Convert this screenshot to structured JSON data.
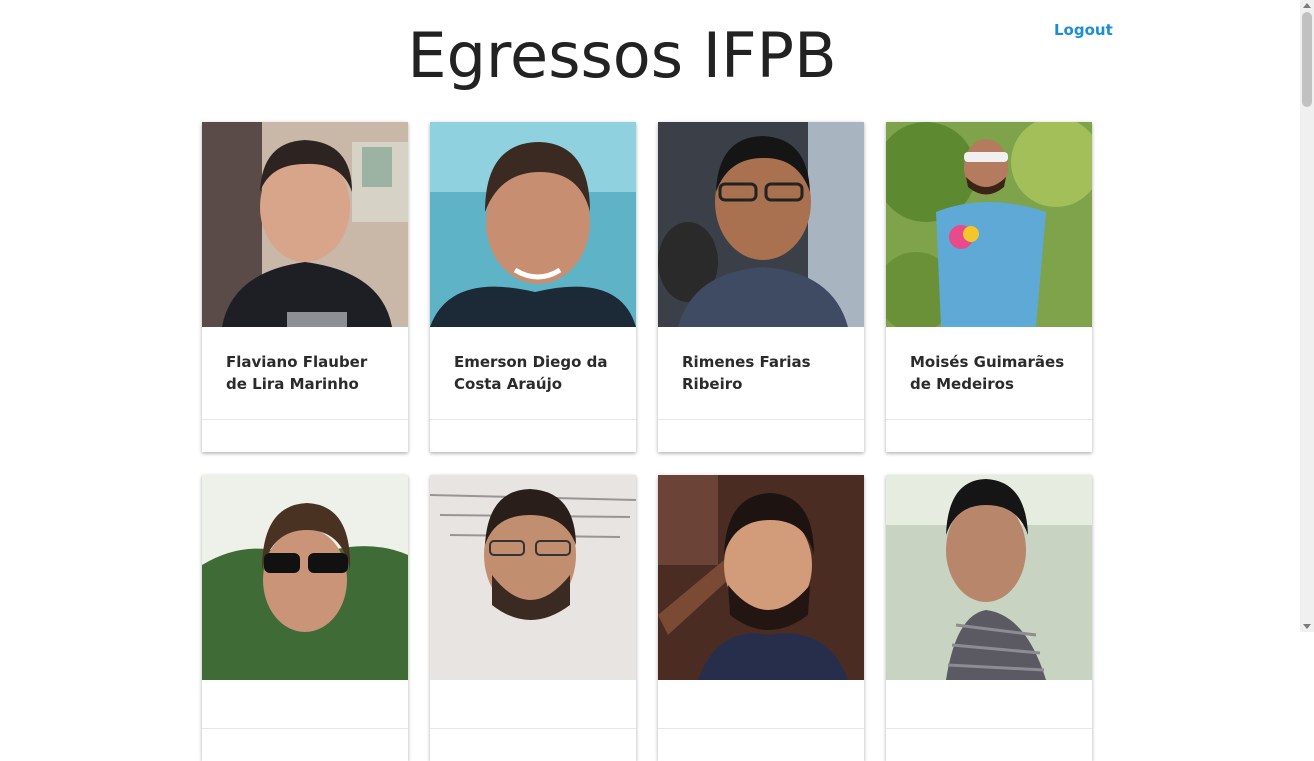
{
  "header": {
    "title": "Egressos IFPB",
    "logout_label": "Logout"
  },
  "colors": {
    "link": "#1a8fd6",
    "text": "#222222",
    "card_border": "#e6e6e6"
  },
  "alumni": [
    {
      "name": "Flaviano Flauber de Lira Marinho",
      "photo": "portrait-photo"
    },
    {
      "name": "Emerson Diego da Costa Araújo",
      "photo": "portrait-photo"
    },
    {
      "name": "Rimenes Farias Ribeiro",
      "photo": "portrait-photo"
    },
    {
      "name": "Moisés Guimarães de Medeiros",
      "photo": "portrait-photo"
    },
    {
      "name": "",
      "photo": "portrait-photo"
    },
    {
      "name": "",
      "photo": "portrait-photo"
    },
    {
      "name": "",
      "photo": "portrait-photo"
    },
    {
      "name": "",
      "photo": "portrait-photo"
    }
  ]
}
